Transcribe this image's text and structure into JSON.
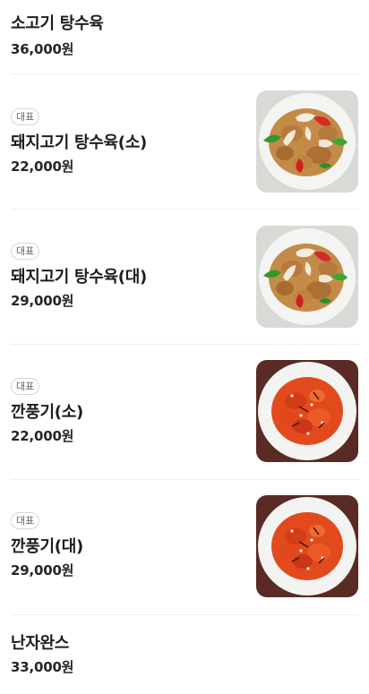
{
  "menu": {
    "items": [
      {
        "name": "소고기 탕수육",
        "price": "36,000원"
      },
      {
        "badge": "대표",
        "name": "돼지고기 탕수육(소)",
        "price": "22,000원",
        "image": "sweet-sour-pork-photo"
      },
      {
        "badge": "대표",
        "name": "돼지고기 탕수육(대)",
        "price": "29,000원",
        "image": "sweet-sour-pork-photo"
      },
      {
        "badge": "대표",
        "name": "깐풍기(소)",
        "price": "22,000원",
        "image": "kkanpunggi-photo"
      },
      {
        "badge": "대표",
        "name": "깐풍기(대)",
        "price": "29,000원",
        "image": "kkanpunggi-photo"
      },
      {
        "name": "난자완스",
        "price": "33,000원"
      }
    ]
  }
}
